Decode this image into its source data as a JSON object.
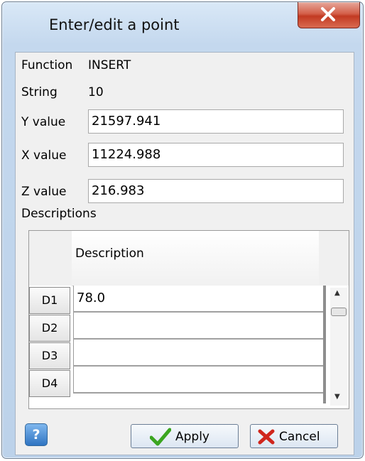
{
  "window": {
    "title": "Enter/edit a point"
  },
  "fields": {
    "function_label": "Function",
    "function_value": "INSERT",
    "string_label": "String",
    "string_value": "10",
    "y_label": "Y value",
    "y_value": "21597.941",
    "x_label": "X value",
    "x_value": "11224.988",
    "z_label": "Z value",
    "z_value": "216.983"
  },
  "descriptions": {
    "section_label": "Descriptions",
    "column_header": "Description",
    "rows": [
      {
        "id": "D1",
        "value": "78.0"
      },
      {
        "id": "D2",
        "value": ""
      },
      {
        "id": "D3",
        "value": ""
      },
      {
        "id": "D4",
        "value": ""
      }
    ]
  },
  "buttons": {
    "help": "?",
    "apply": "Apply",
    "cancel": "Cancel"
  },
  "icons": {
    "close": "close-icon",
    "help": "help-icon",
    "apply": "checkmark-icon",
    "cancel": "red-x-icon"
  },
  "colors": {
    "close_button": "#c94a32",
    "apply_check": "#3ba520",
    "cancel_x": "#d0261d"
  }
}
